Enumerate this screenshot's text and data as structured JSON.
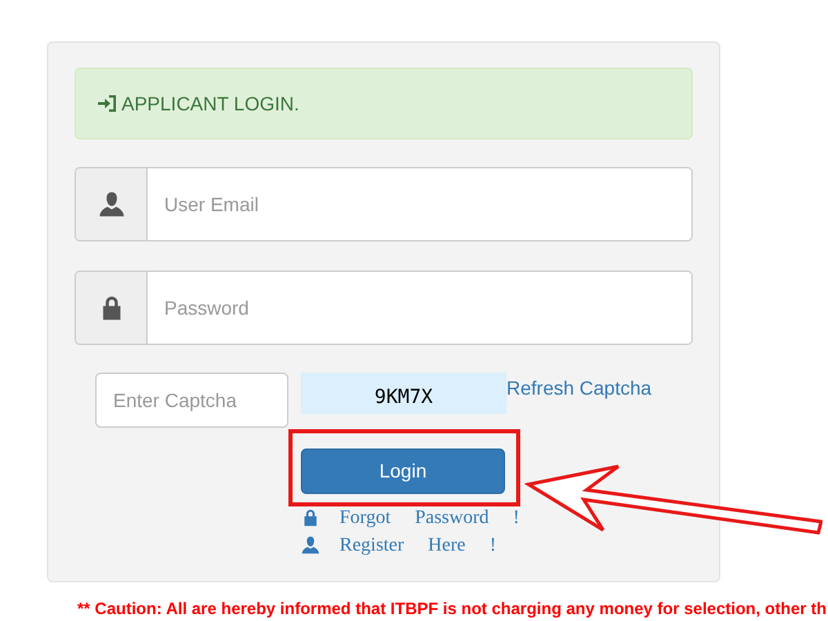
{
  "alert": {
    "title": "APPLICANT LOGIN."
  },
  "fields": [
    {
      "kind": "user",
      "placeholder": "User Email"
    },
    {
      "kind": "lock",
      "placeholder": "Password"
    }
  ],
  "captcha": {
    "placeholder": "Enter Captcha",
    "code": "9KM7X",
    "refresh": "Refresh Captcha"
  },
  "login_button": "Login",
  "links": [
    {
      "kind": "lock",
      "label": "Forgot Password !"
    },
    {
      "kind": "user",
      "label": "Register Here !"
    }
  ],
  "caution": "** Caution: All are hereby informed that ITBPF is not charging any money for selection, other th",
  "annotation": {
    "highlight": true,
    "arrow": true
  }
}
